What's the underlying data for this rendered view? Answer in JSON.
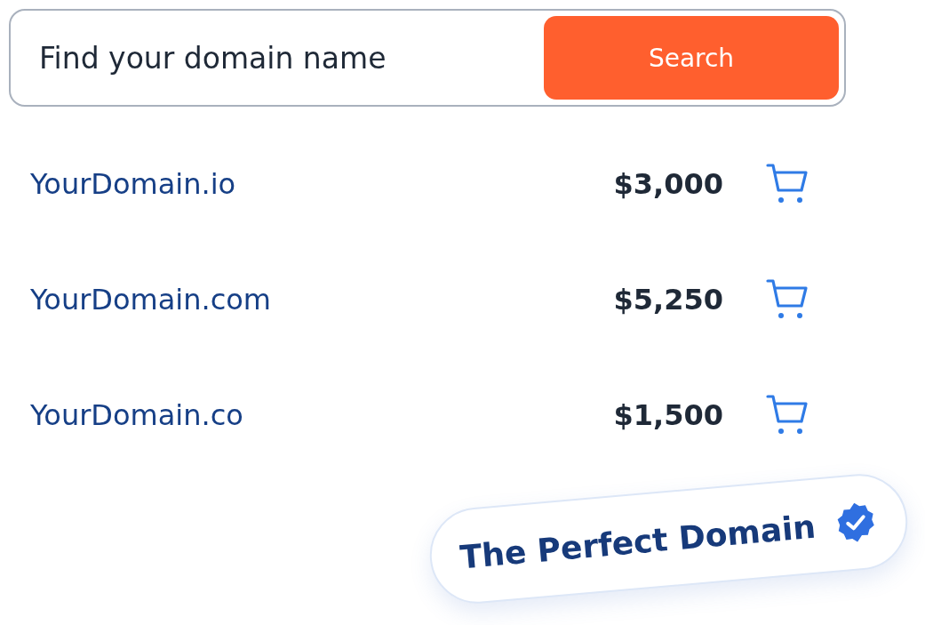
{
  "search": {
    "placeholder": "Find your domain name",
    "button": "Search"
  },
  "domains": [
    {
      "name": "YourDomain.io",
      "price": "$3,000"
    },
    {
      "name": "YourDomain.com",
      "price": "$5,250"
    },
    {
      "name": "YourDomain.co",
      "price": "$1,500"
    }
  ],
  "badge": {
    "label": "The Perfect Domain"
  }
}
